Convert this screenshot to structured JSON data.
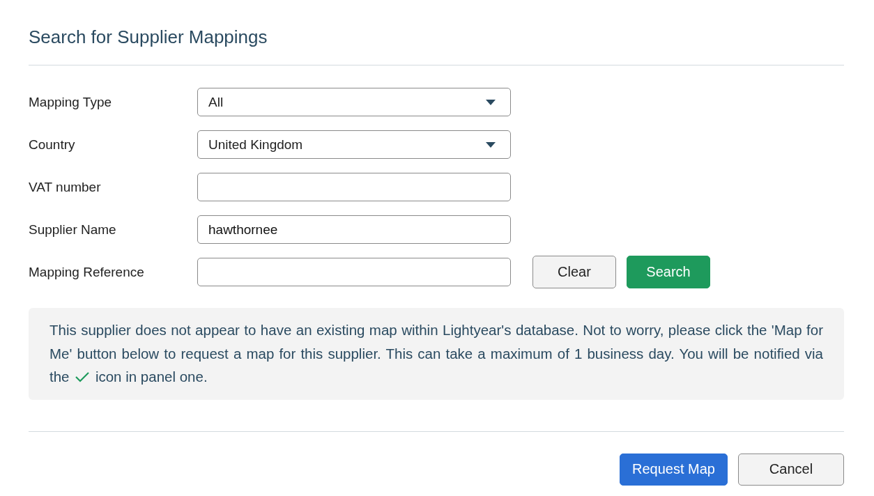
{
  "dialog": {
    "title": "Search for Supplier Mappings"
  },
  "fields": [
    {
      "kind": "select",
      "label": "Mapping Type",
      "value": "All"
    },
    {
      "kind": "select",
      "label": "Country",
      "value": "United Kingdom"
    },
    {
      "kind": "text",
      "label": "VAT number"
    },
    {
      "kind": "text",
      "label": "Supplier Name",
      "value": "hawthornee"
    },
    {
      "kind": "text",
      "label": "Mapping Reference"
    }
  ],
  "form_buttons": [
    {
      "label": "Clear",
      "kind": "secondary"
    },
    {
      "label": "Search",
      "kind": "success"
    }
  ],
  "notice": {
    "text_before": "This supplier does not appear to have an existing map within Lightyear's database. Not to worry, please click the 'Map for Me' button below to request a map for this supplier. This can take a maximum of 1 business day. You will be notified via the",
    "text_after": "icon in panel one."
  },
  "footer_buttons": [
    {
      "label": "Request Map",
      "kind": "primary"
    },
    {
      "label": "Cancel",
      "kind": "secondary"
    }
  ]
}
